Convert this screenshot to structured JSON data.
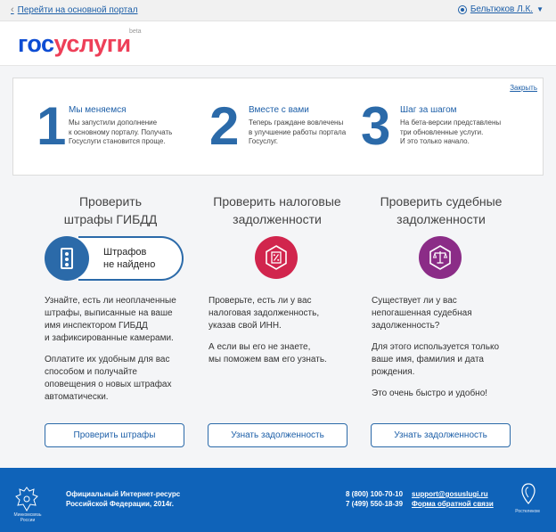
{
  "topbar": {
    "back_link": "Перейти на основной портал",
    "user_name": "Бельтюков Л.К."
  },
  "header": {
    "logo_part1": "гос",
    "logo_part2": "услуги",
    "logo_badge": "beta"
  },
  "banner": {
    "close_label": "Закрыть",
    "steps": [
      {
        "number": "1",
        "title": "Мы меняемся",
        "lines": [
          "Мы запустили дополнение",
          "к основному порталу. Получать",
          "Госуслуги становится проще."
        ]
      },
      {
        "number": "2",
        "title": "Вместе с вами",
        "lines": [
          "Теперь граждане вовлечены",
          "в улучшение работы портала",
          "Госуслуг."
        ]
      },
      {
        "number": "3",
        "title": "Шаг за шагом",
        "lines": [
          "На бета-версии представлены",
          "три обновленные услуги.",
          "И это только начало."
        ]
      }
    ]
  },
  "services": [
    {
      "title_lines": [
        "Проверить",
        "штрафы ГИБДД"
      ],
      "badge_lines": [
        "Штрафов",
        "не найдено"
      ],
      "paragraphs": [
        [
          "Узнайте, есть ли неоплаченные",
          "штрафы, выписанные на ваше",
          "имя инспектором ГИБДД",
          "и зафиксированные камерами."
        ],
        [
          "Оплатите их удобным для вас",
          "способом и получайте",
          "оповещения о новых штрафах",
          "автоматически."
        ]
      ],
      "button": "Проверить штрафы",
      "icon": "traffic-light-icon",
      "color": "#2b6aa9"
    },
    {
      "title_lines": [
        "Проверить налоговые",
        "задолженности"
      ],
      "paragraphs": [
        [
          "Проверьте, есть ли у вас",
          "налоговая задолженность,",
          "указав свой ИНН."
        ],
        [
          "А если вы его не знаете,",
          "мы поможем вам его узнать."
        ]
      ],
      "button": "Узнать задолженность",
      "icon": "tax-percent-icon",
      "color": "#d1254d"
    },
    {
      "title_lines": [
        "Проверить судебные",
        "задолженности"
      ],
      "paragraphs": [
        [
          "Существует ли у вас",
          "непогашенная судебная",
          "задолженность?"
        ],
        [
          "Для этого используется только",
          "ваше имя, фамилия и дата",
          "рождения."
        ],
        [
          "Это очень быстро и удобно!"
        ]
      ],
      "button": "Узнать задолженность",
      "icon": "scales-icon",
      "color": "#8b2c87"
    }
  ],
  "footer": {
    "emblem_label_lines": [
      "Минкомсвязь",
      "России"
    ],
    "info_lines": [
      "Официальный Интернет-ресурс",
      "Российской Федерации, 2014г."
    ],
    "phones": [
      "8 (800) 100-70-10",
      "7 (499) 550-18-39"
    ],
    "email": "support@gosuslugi.ru",
    "feedback": "Форма обратной связи",
    "partner": "Ростелеком"
  }
}
